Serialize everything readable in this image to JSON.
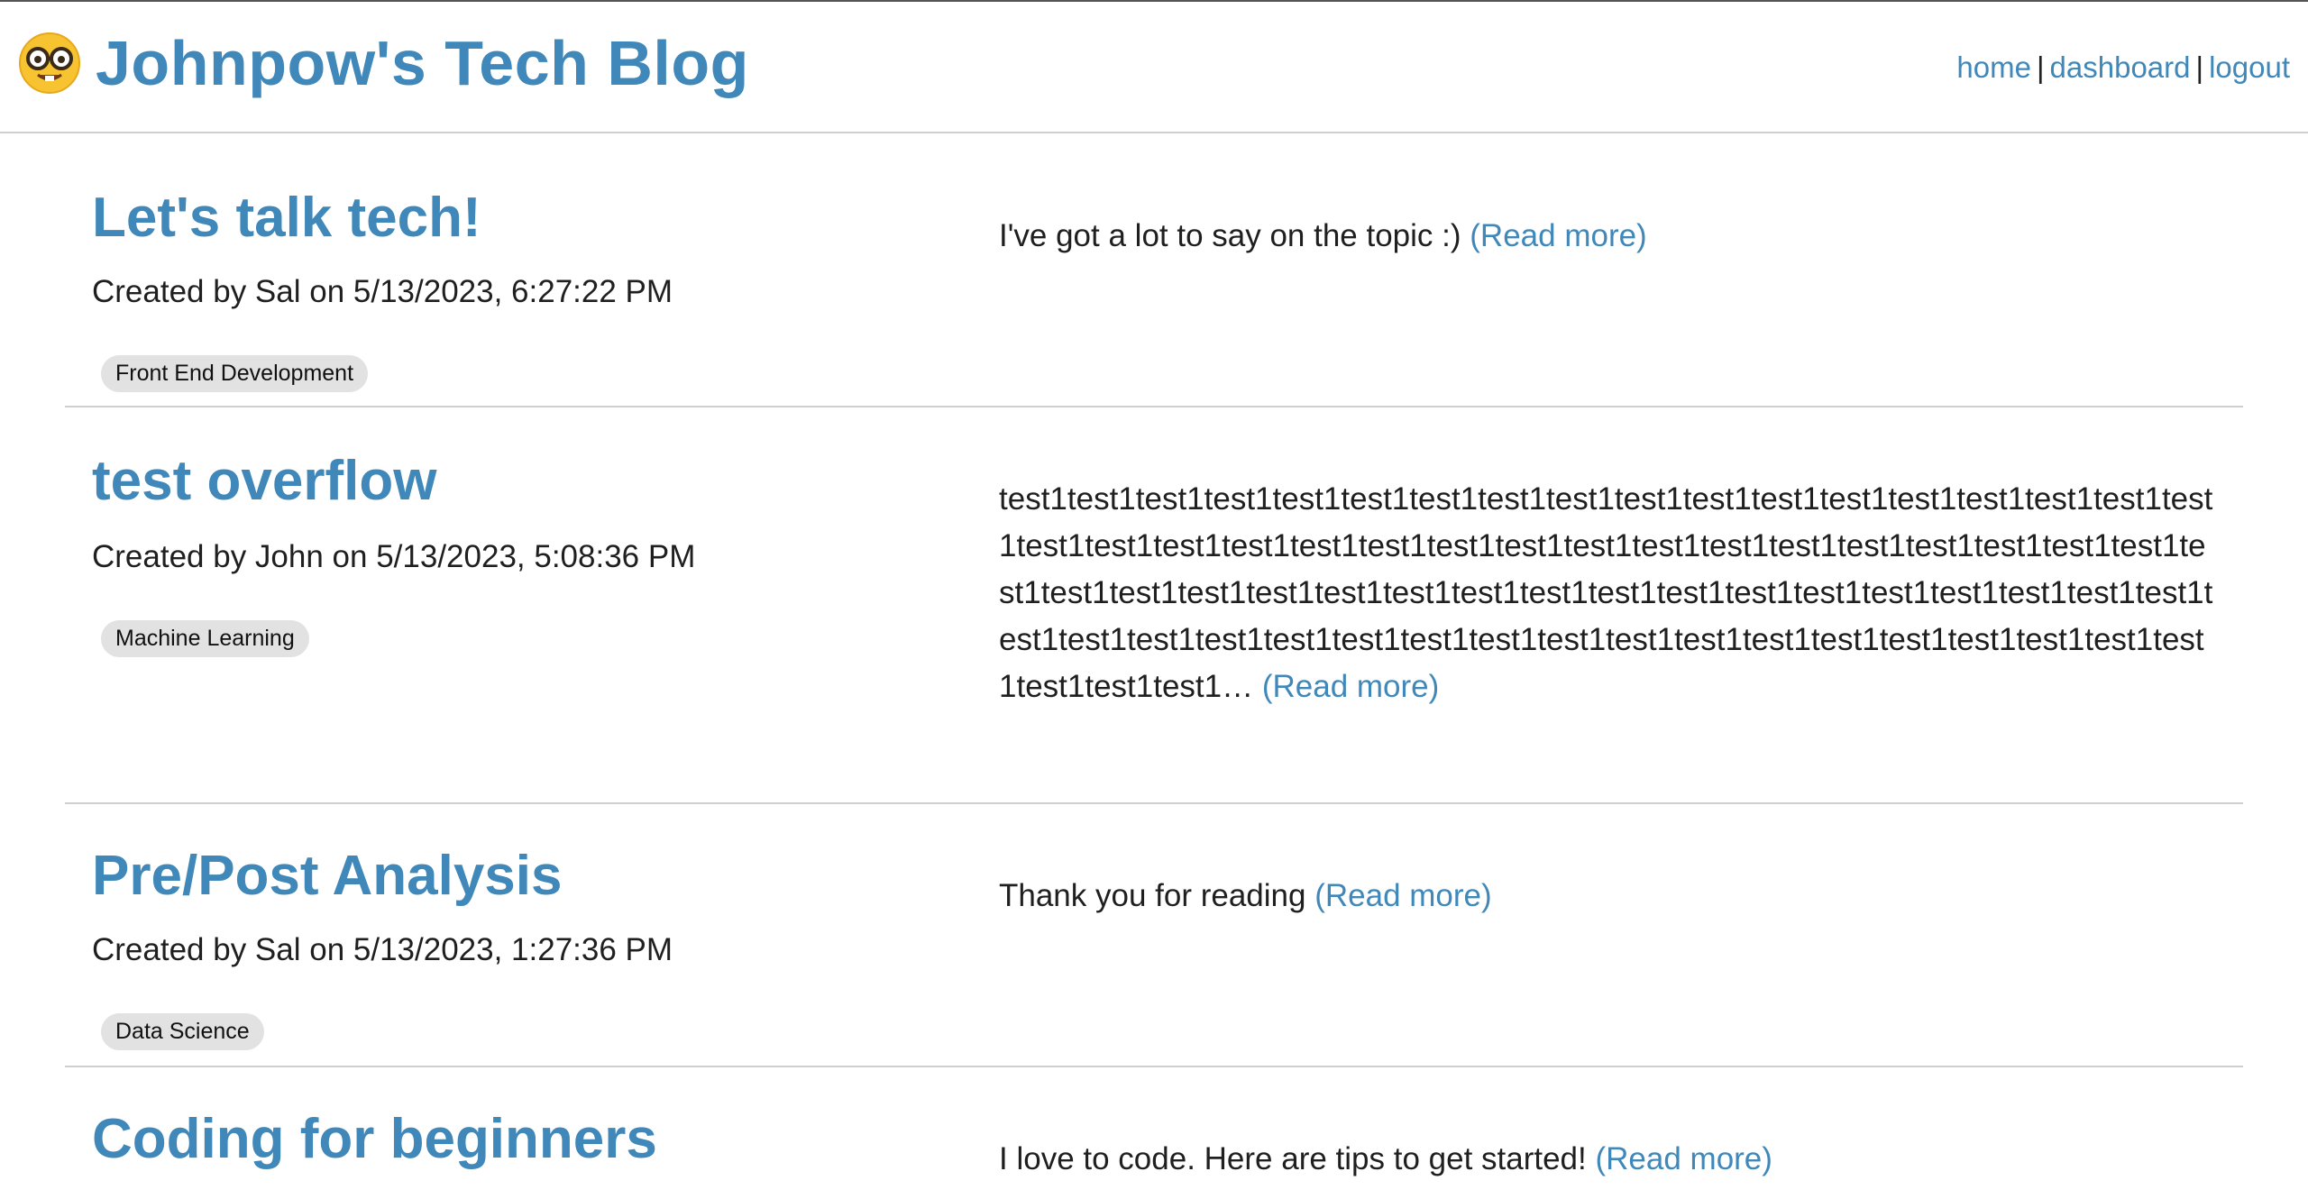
{
  "header": {
    "title": "Johnpow's Tech Blog",
    "nav": [
      {
        "label": "home"
      },
      {
        "label": "dashboard"
      },
      {
        "label": "logout"
      }
    ],
    "separator": "|"
  },
  "posts": [
    {
      "title": "Let's talk tech!",
      "meta": "Created by Sal on 5/13/2023, 6:27:22 PM",
      "tag": "Front End Development",
      "excerpt": "I've got a lot to say on the topic :)",
      "read_more": "(Read more)"
    },
    {
      "title": "test overflow",
      "meta": "Created by John on 5/13/2023, 5:08:36 PM",
      "tag": "Machine Learning",
      "excerpt": "test1test1test1test1test1test1test1test1test1test1test1test1test1test1test1test1test1test1test1test1test1test1test1test1test1test1test1test1test1test1test1test1test1test1test1test1test1test1test1test1test1test1test1test1test1test1test1test1test1test1test1test1test1test1test1test1test1test1test1test1test1test1test1test1test1test1test1test1test1test1test1test1test1test1…",
      "read_more": "(Read more)"
    },
    {
      "title": "Pre/Post Analysis",
      "meta": "Created by Sal on 5/13/2023, 1:27:36 PM",
      "tag": "Data Science",
      "excerpt": "Thank you for reading",
      "read_more": "(Read more)"
    },
    {
      "title": "Coding for beginners",
      "meta": "",
      "tag": "",
      "excerpt": "I love to code. Here are tips to get started!",
      "read_more": "(Read more)"
    }
  ],
  "colors": {
    "accent": "#3f88b9",
    "tag_bg": "#e2e2e2",
    "divider": "#cfcfcf"
  },
  "icons": {
    "logo": "nerd-face-emoji-icon"
  }
}
